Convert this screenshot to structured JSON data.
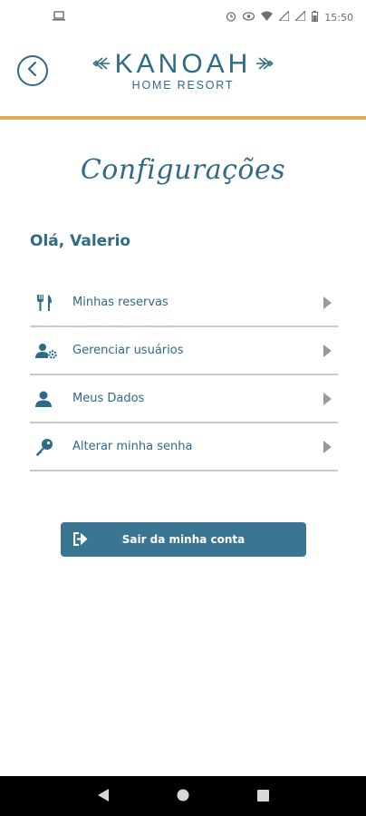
{
  "status_bar": {
    "time": "15:50",
    "icons": [
      "laptop-icon",
      "alarm-icon",
      "eye-icon",
      "wifi-icon",
      "signal-icon",
      "signal-icon",
      "battery-icon"
    ]
  },
  "header": {
    "back_icon": "chevron-left-icon",
    "logo_main": "KANOAH",
    "logo_sub": "HOME RESORT"
  },
  "page": {
    "title": "Configurações",
    "greeting": "Olá, Valerio"
  },
  "menu": {
    "items": [
      {
        "label": "Minhas reservas",
        "icon": "utensils-icon"
      },
      {
        "label": "Gerenciar usuários",
        "icon": "users-gear-icon"
      },
      {
        "label": "Meus Dados",
        "icon": "user-icon"
      },
      {
        "label": "Alterar minha senha",
        "icon": "key-icon"
      }
    ]
  },
  "logout": {
    "label": "Sair da minha conta",
    "icon": "sign-out-icon"
  },
  "colors": {
    "primary": "#2f6a86",
    "accent": "#e1ad52",
    "button": "#3a7593"
  }
}
